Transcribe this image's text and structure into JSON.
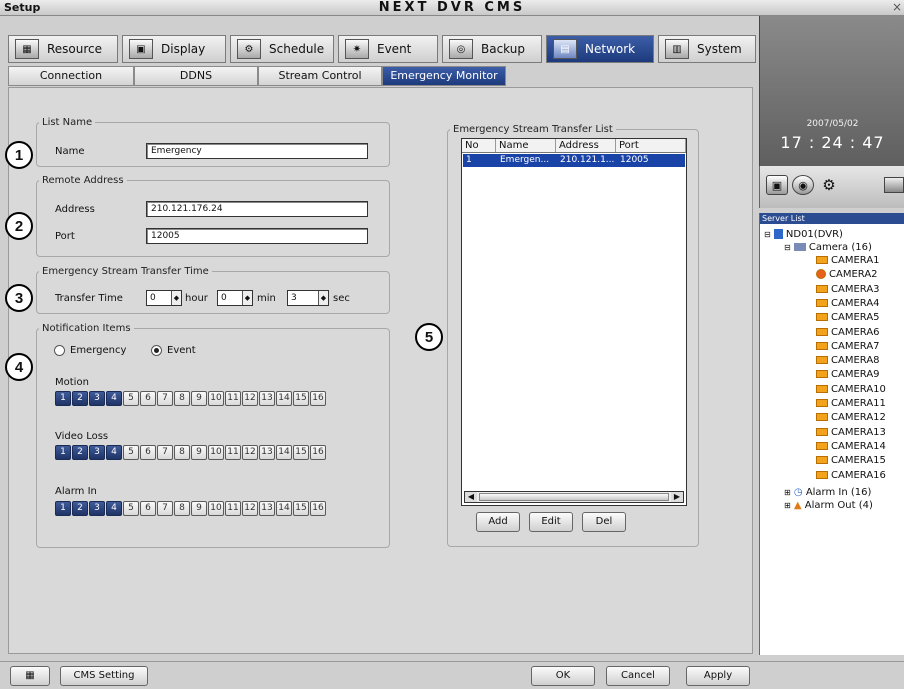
{
  "window": {
    "label": "Setup",
    "title": "NEXT DVR CMS",
    "close_glyph": "×"
  },
  "main_tabs": [
    {
      "label": "Resource",
      "icon": "resource-icon"
    },
    {
      "label": "Display",
      "icon": "display-icon"
    },
    {
      "label": "Schedule",
      "icon": "schedule-icon"
    },
    {
      "label": "Event",
      "icon": "event-icon"
    },
    {
      "label": "Backup",
      "icon": "backup-icon"
    },
    {
      "label": "Network",
      "icon": "network-icon",
      "active": true
    },
    {
      "label": "System",
      "icon": "system-icon"
    }
  ],
  "sub_tabs": [
    {
      "label": "Connection"
    },
    {
      "label": "DDNS"
    },
    {
      "label": "Stream Control"
    },
    {
      "label": "Emergency Monitor",
      "active": true
    }
  ],
  "list_name": {
    "legend": "List Name",
    "name_label": "Name",
    "name_value": "Emergency"
  },
  "remote_address": {
    "legend": "Remote Address",
    "address_label": "Address",
    "address_value": "210.121.176.24",
    "port_label": "Port",
    "port_value": "12005"
  },
  "transfer_time": {
    "legend": "Emergency Stream Transfer Time",
    "label": "Transfer Time",
    "hour_value": "0",
    "hour_unit": "hour",
    "min_value": "0",
    "min_unit": "min",
    "sec_value": "3",
    "sec_unit": "sec"
  },
  "notification": {
    "legend": "Notification Items",
    "opt_emergency": "Emergency",
    "opt_event": "Event",
    "selected": "Event",
    "groups": [
      {
        "label": "Motion",
        "channels": [
          "1",
          "2",
          "3",
          "4",
          "5",
          "6",
          "7",
          "8",
          "9",
          "10",
          "11",
          "12",
          "13",
          "14",
          "15",
          "16"
        ],
        "selected": [
          1,
          2,
          3,
          4
        ]
      },
      {
        "label": "Video Loss",
        "channels": [
          "1",
          "2",
          "3",
          "4",
          "5",
          "6",
          "7",
          "8",
          "9",
          "10",
          "11",
          "12",
          "13",
          "14",
          "15",
          "16"
        ],
        "selected": [
          1,
          2,
          3,
          4
        ]
      },
      {
        "label": "Alarm In",
        "channels": [
          "1",
          "2",
          "3",
          "4",
          "5",
          "6",
          "7",
          "8",
          "9",
          "10",
          "11",
          "12",
          "13",
          "14",
          "15",
          "16"
        ],
        "selected": [
          1,
          2,
          3,
          4
        ]
      }
    ]
  },
  "transfer_list": {
    "legend": "Emergency Stream Transfer List",
    "columns": [
      "No",
      "Name",
      "Address",
      "Port"
    ],
    "rows": [
      [
        "1",
        "Emergen...",
        "210.121.1...",
        "12005"
      ]
    ],
    "buttons": {
      "add": "Add",
      "edit": "Edit",
      "del": "Del"
    }
  },
  "callouts": [
    "1",
    "2",
    "3",
    "4",
    "5"
  ],
  "clock": {
    "date": "2007/05/02",
    "time": "17 : 24 : 47"
  },
  "server_list": {
    "header": "Server List",
    "server": "ND01(DVR)",
    "camera_group": "Camera (16)",
    "cameras": [
      "CAMERA1",
      "CAMERA2",
      "CAMERA3",
      "CAMERA4",
      "CAMERA5",
      "CAMERA6",
      "CAMERA7",
      "CAMERA8",
      "CAMERA9",
      "CAMERA10",
      "CAMERA11",
      "CAMERA12",
      "CAMERA13",
      "CAMERA14",
      "CAMERA15",
      "CAMERA16"
    ],
    "alarm_in": "Alarm In (16)",
    "alarm_out": "Alarm Out (4)"
  },
  "bottom": {
    "cms_setting": "CMS Setting",
    "ok": "OK",
    "cancel": "Cancel",
    "apply": "Apply"
  },
  "colors": {
    "accent": "#1d3a7c",
    "selected_row": "#1a43a8",
    "camera_icon": "#f2a31b"
  }
}
